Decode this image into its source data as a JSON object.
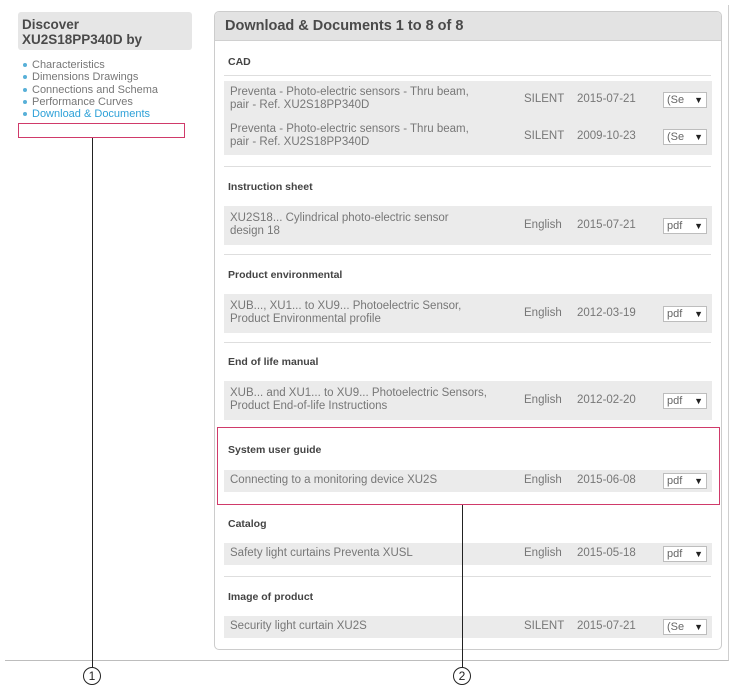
{
  "sidebar": {
    "title_line1": "Discover",
    "title_line2": "XU2S18PP340D by",
    "items": [
      {
        "label": "Characteristics"
      },
      {
        "label": "Dimensions Drawings"
      },
      {
        "label": "Connections and Schema"
      },
      {
        "label": "Performance Curves"
      },
      {
        "label": "Download & Documents"
      }
    ]
  },
  "main": {
    "header": "Download & Documents 1 to 8 of 8",
    "sections": [
      {
        "title": "CAD",
        "rows": [
          {
            "desc1": "Preventa - Photo-electric sensors - Thru beam,",
            "desc2": "pair - Ref. XU2S18PP340D",
            "lang": "SILENT",
            "date": "2015-07-21",
            "format": "(Se"
          },
          {
            "desc1": "Preventa - Photo-electric sensors - Thru beam,",
            "desc2": "pair - Ref. XU2S18PP340D",
            "lang": "SILENT",
            "date": "2009-10-23",
            "format": "(Se"
          }
        ]
      },
      {
        "title": "Instruction sheet",
        "rows": [
          {
            "desc1": "XU2S18... Cylindrical photo-electric sensor",
            "desc2": "design 18",
            "lang": "English",
            "date": "2015-07-21",
            "format": "pdf"
          }
        ]
      },
      {
        "title": "Product environmental",
        "rows": [
          {
            "desc1": "XUB..., XU1... to XU9... Photoelectric Sensor,",
            "desc2": "Product Environmental profile",
            "lang": "English",
            "date": "2012-03-19",
            "format": "pdf"
          }
        ]
      },
      {
        "title": "End of life manual",
        "rows": [
          {
            "desc1": "XUB... and XU1... to XU9... Photoelectric Sensors,",
            "desc2": "Product End-of-life Instructions",
            "lang": "English",
            "date": "2012-02-20",
            "format": "pdf"
          }
        ]
      },
      {
        "title": "System user guide",
        "rows": [
          {
            "desc1": "Connecting to a monitoring device XU2S",
            "lang": "English",
            "date": "2015-06-08",
            "format": "pdf"
          }
        ]
      },
      {
        "title": "Catalog",
        "rows": [
          {
            "desc1": "Safety light curtains Preventa XUSL",
            "lang": "English",
            "date": "2015-05-18",
            "format": "pdf"
          }
        ]
      },
      {
        "title": "Image of product",
        "rows": [
          {
            "desc1": "Security light curtain XU2S",
            "lang": "SILENT",
            "date": "2015-07-21",
            "format": "(Se"
          }
        ]
      }
    ]
  },
  "callouts": {
    "one": "1",
    "two": "2"
  },
  "icons": {
    "select_arrow": "triangle-down-icon"
  },
  "colors": {
    "highlight": "#d03a6a",
    "link": "#2ea1d8"
  }
}
